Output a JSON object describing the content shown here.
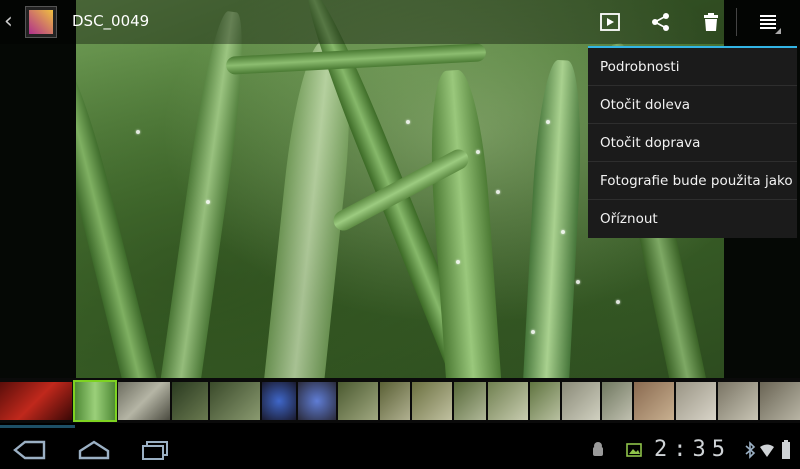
{
  "header": {
    "title": "DSC_0049",
    "icons": {
      "back": "chevron-left-icon",
      "app": "gallery-thumbnail-icon",
      "slideshow": "play-icon",
      "share": "share-icon",
      "delete": "trash-icon",
      "menu": "overflow-menu-icon"
    }
  },
  "menu": {
    "items": [
      {
        "label": "Podrobnosti"
      },
      {
        "label": "Otočit doleva"
      },
      {
        "label": "Otočit doprava"
      },
      {
        "label": "Fotografie bude použita jako"
      },
      {
        "label": "Oříznout"
      }
    ]
  },
  "filmstrip": {
    "thumbnails": [
      {
        "desc": "red berries",
        "color": "#8b1a12"
      },
      {
        "desc": "grass (selected)",
        "color": "#6aa84f"
      },
      {
        "desc": "cat",
        "color": "#7f7f74"
      },
      {
        "desc": "motocross rider",
        "color": "#3b4a2c"
      },
      {
        "desc": "motocross rider",
        "color": "#4a5a3a"
      },
      {
        "desc": "helmet",
        "color": "#5b5a56"
      },
      {
        "desc": "helmet",
        "color": "#2a2a44"
      },
      {
        "desc": "helmet",
        "color": "#6a7080"
      },
      {
        "desc": "rider",
        "color": "#4b5a30"
      },
      {
        "desc": "rider",
        "color": "#5a6035"
      },
      {
        "desc": "rider",
        "color": "#6b7040"
      },
      {
        "desc": "rider",
        "color": "#566838"
      },
      {
        "desc": "rider",
        "color": "#708050"
      },
      {
        "desc": "rider",
        "color": "#607440"
      },
      {
        "desc": "rider",
        "color": "#a0a090"
      },
      {
        "desc": "house",
        "color": "#8a7a60"
      },
      {
        "desc": "rider",
        "color": "#9a9585"
      },
      {
        "desc": "rider",
        "color": "#7a7565"
      }
    ]
  },
  "navbar": {
    "icons": {
      "back": "back-icon",
      "home": "home-icon",
      "recents": "recent-apps-icon",
      "android": "android-debug-icon",
      "gallery": "gallery-status-icon",
      "wifi": "wifi-icon",
      "bluetooth": "bluetooth-icon",
      "battery": "battery-icon"
    },
    "time": "2:35"
  },
  "colors": {
    "accent": "#33b5e5",
    "selection": "#7ed321",
    "menu_bg": "#1b1b1b"
  }
}
